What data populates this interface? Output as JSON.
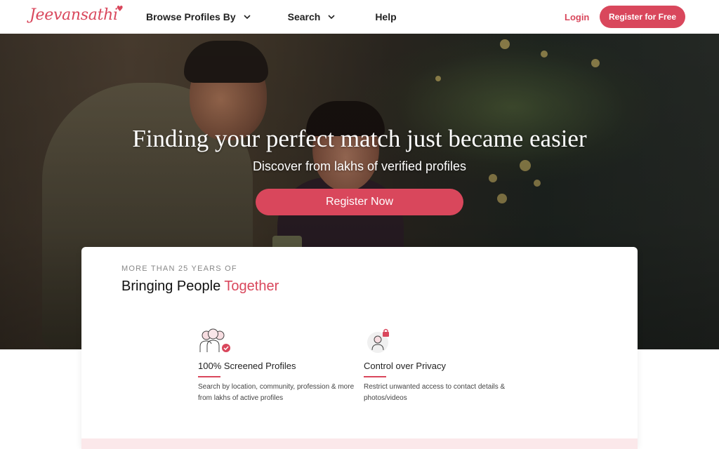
{
  "header": {
    "logo": "Jeevansathi",
    "nav": [
      {
        "label": "Browse Profiles By",
        "icon": "chevron-down-icon"
      },
      {
        "label": "Search",
        "icon": "chevron-down-icon"
      },
      {
        "label": "Help"
      }
    ],
    "login_label": "Login",
    "register_label": "Register for Free"
  },
  "hero": {
    "title": "Finding your perfect match just became easier",
    "subtitle": "Discover from lakhs of verified profiles",
    "cta_label": "Register Now"
  },
  "card": {
    "kicker": "MORE THAN 25 YEARS OF",
    "title_main": "Bringing People",
    "title_accent": "Together",
    "features": [
      {
        "icon": "screened-profiles-icon",
        "title": "100% Screened Profiles",
        "description": "Search by location, community, profession & more from lakhs of active profiles"
      },
      {
        "icon": "privacy-lock-icon",
        "title": "Control over Privacy",
        "description": "Restrict unwanted access to contact details & photos/videos"
      }
    ]
  },
  "colors": {
    "brand": "#d9475c",
    "strip": "#fbe8ea"
  }
}
